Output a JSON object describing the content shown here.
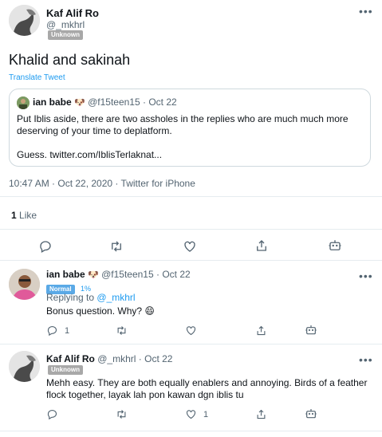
{
  "main_tweet": {
    "author_name": "Kaf Alif Ro",
    "handle": "@_mkhrl",
    "badge": "Unknown",
    "text": "Khalid and sakinah",
    "translate_label": "Translate Tweet",
    "quote": {
      "author_name": "ian babe",
      "emoji": "🐶",
      "handle": "@f15teen15",
      "separator": "·",
      "date": "Oct 22",
      "text_line1": "Put Iblis aside, there are two assholes in the replies who are much much more",
      "text_line2": "deserving of your time to deplatform.",
      "text_line3": "Guess. twitter.com/IblisTerlaknat..."
    },
    "meta": "10:47 AM · Oct 22, 2020 · Twitter for iPhone",
    "like_count": "1",
    "like_label": "Like"
  },
  "reply1": {
    "author_name": "ian babe",
    "emoji": "🐶",
    "handle": "@f15teen15",
    "separator": "·",
    "date": "Oct 22",
    "badge": "Normal",
    "badge_percent": "1%",
    "replying_prefix": "Replying to",
    "replying_handle": "@_mkhrl",
    "text": "Bonus question. Why?",
    "text_emoji": "😄",
    "reply_count": "1"
  },
  "reply2": {
    "author_name": "Kaf Alif Ro",
    "handle": "@_mkhrl",
    "separator": "·",
    "date": "Oct 22",
    "badge": "Unknown",
    "text_line1": "Mehh easy. They are both equally enablers and annoying. Birds of a feather",
    "text_line2": "flock together, layak lah pon kawan dgn iblis tu",
    "like_count": "1"
  },
  "more_label": "•••",
  "colors": {
    "accent": "#1d9bf0",
    "secondary_text": "#536471",
    "border": "#cfd9de",
    "badge_unknown": "#a8a8a8",
    "badge_normal": "#5aa9e6"
  }
}
